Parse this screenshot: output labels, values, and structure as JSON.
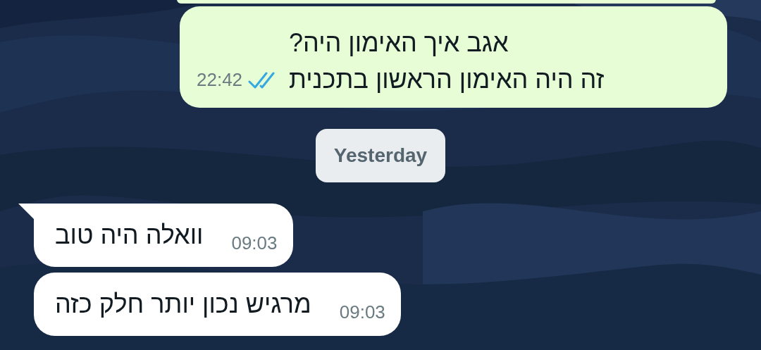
{
  "messages": [
    {
      "kind": "outgoing",
      "lines": [
        "אגב איך האימון היה?",
        "זה היה האימון הראשון בתכנית"
      ],
      "time": "22:42",
      "read": true,
      "tail": false
    },
    {
      "kind": "date",
      "text": "Yesterday"
    },
    {
      "kind": "incoming",
      "lines": [
        "וואלה היה טוב"
      ],
      "time": "09:03",
      "tail": true
    },
    {
      "kind": "incoming",
      "lines": [
        "מרגיש נכון יותר חלק כזה"
      ],
      "time": "09:03",
      "tail": false
    }
  ]
}
